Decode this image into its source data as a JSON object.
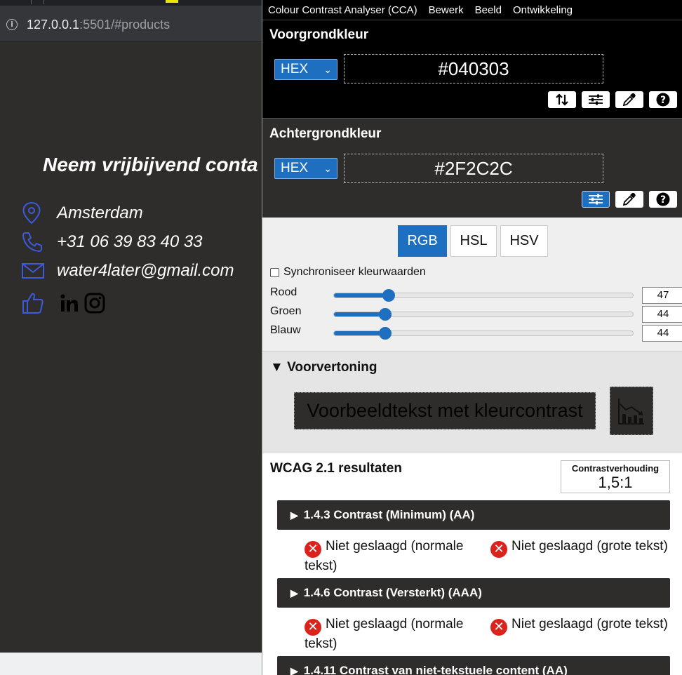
{
  "browser": {
    "url_host": "127.0.0.1",
    "url_rest": ":5501/#products"
  },
  "website": {
    "heading": "Neem vrijbijvend conta",
    "contacts": [
      {
        "icon": "location-pin-icon",
        "text": "Amsterdam"
      },
      {
        "icon": "phone-icon",
        "text": "+31 06 39 83 40 33"
      },
      {
        "icon": "envelope-icon",
        "text": "water4later@gmail.com"
      }
    ],
    "social_icons": [
      "thumbs-up-icon",
      "linkedin-icon",
      "instagram-icon"
    ]
  },
  "cca": {
    "menu": [
      "Colour Contrast Analyser (CCA)",
      "Bewerk",
      "Beeld",
      "Ontwikkeling"
    ],
    "foreground": {
      "title": "Voorgrondkleur",
      "format": "HEX",
      "value": "#040303"
    },
    "background": {
      "title": "Achtergrondkleur",
      "format": "HEX",
      "value": "#2F2C2C"
    },
    "modes": [
      "RGB",
      "HSL",
      "HSV"
    ],
    "active_mode": "RGB",
    "sync_label": "Synchroniseer kleurwaarden",
    "sync_checked": false,
    "sliders": [
      {
        "label": "Rood",
        "value": "47",
        "fraction": 0.184
      },
      {
        "label": "Groen",
        "value": "44",
        "fraction": 0.173
      },
      {
        "label": "Blauw",
        "value": "44",
        "fraction": 0.173
      }
    ],
    "preview": {
      "title": "Voorvertoning",
      "sample_text": "Voorbeeldtekst met kleurcontrast"
    },
    "wcag": {
      "title": "WCAG 2.1 resultaten",
      "ratio_label": "Contrastverhouding",
      "ratio_value": "1,5:1",
      "criteria": [
        {
          "header": "1.4.3 Contrast (Minimum) (AA)",
          "result_normal": "Niet geslaagd (normale tekst)",
          "result_large": "Niet geslaagd (grote tekst)"
        },
        {
          "header": "1.4.6 Contrast (Versterkt) (AAA)",
          "result_normal": "Niet geslaagd (normale tekst)",
          "result_large": "Niet geslaagd (grote tekst)"
        },
        {
          "header": "1.4.11 Contrast van niet-tekstuele content (AA)"
        }
      ]
    }
  },
  "colors": {
    "accent": "#1f6fc1",
    "fail": "#d9231c",
    "page_background": "#2f2c2c",
    "icon_blue": "#3b5bdb"
  }
}
